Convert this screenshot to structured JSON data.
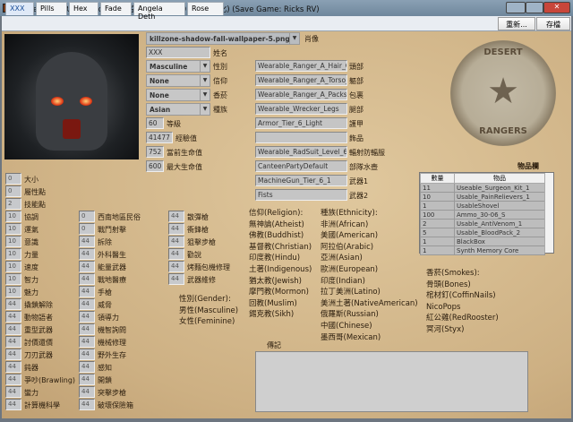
{
  "window": {
    "title": "Wasteland 2 Ranger Editor (天空的暑假(a8690145)中文化) (Save Game: Ricks RV)"
  },
  "tabs": [
    "XXX",
    "Pills",
    "Hex",
    "Fade",
    "Angela Deth",
    "Rose"
  ],
  "toolbar": {
    "reload": "重新...",
    "save": "存檔"
  },
  "portrait": {
    "value": "killzone-shadow-fall-wallpaper-5.png",
    "label": "肖像"
  },
  "name": {
    "value": "XXX",
    "label": "姓名"
  },
  "selects": [
    {
      "value": "Masculine",
      "label": "性別"
    },
    {
      "value": "None",
      "label": "信仰"
    },
    {
      "value": "None",
      "label": "香菸"
    },
    {
      "value": "Asian",
      "label": "種族"
    }
  ],
  "level_fields": [
    {
      "value": "60",
      "label": "等級"
    },
    {
      "value": "41477",
      "label": "經驗值"
    },
    {
      "value": "752",
      "label": "當前生命值"
    },
    {
      "value": "600",
      "label": "最大生命值"
    }
  ],
  "equipment": [
    {
      "value": "Wearable_Ranger_A_Hair_C",
      "label": "頭部"
    },
    {
      "value": "Wearable_Ranger_A_Torso_E",
      "label": "軀部"
    },
    {
      "value": "Wearable_Ranger_A_Packs_C",
      "label": "包裹"
    },
    {
      "value": "Wearable_Wrecker_Legs",
      "label": "腿部"
    },
    {
      "value": "Armor_Tier_6_Light",
      "label": "護甲"
    },
    {
      "value": "",
      "label": "飾品"
    },
    {
      "value": "Wearable_RadSuit_Level_6",
      "label": "輻射防輻服"
    },
    {
      "value": "CanteenPartyDefault",
      "label": "部隊水壺"
    },
    {
      "value": "MachineGun_Tier_6_1",
      "label": "武器1"
    },
    {
      "value": "Fists",
      "label": "武器2"
    }
  ],
  "stats_col1": [
    {
      "v": "0",
      "l": "大小"
    },
    {
      "v": "0",
      "l": "屬性點"
    },
    {
      "v": "2",
      "l": "技能點"
    },
    {
      "v": "10",
      "l": "協調"
    },
    {
      "v": "10",
      "l": "運氣"
    },
    {
      "v": "10",
      "l": "意識"
    },
    {
      "v": "10",
      "l": "力量"
    },
    {
      "v": "10",
      "l": "速度"
    },
    {
      "v": "10",
      "l": "智力"
    },
    {
      "v": "10",
      "l": "魅力"
    },
    {
      "v": "44",
      "l": "撬鎖解除"
    },
    {
      "v": "44",
      "l": "動物語者"
    },
    {
      "v": "44",
      "l": "重型武器"
    },
    {
      "v": "44",
      "l": "討價還價"
    },
    {
      "v": "44",
      "l": "刀刃武器"
    },
    {
      "v": "44",
      "l": "鈍器"
    },
    {
      "v": "44",
      "l": "爭吵(Brawling)"
    },
    {
      "v": "44",
      "l": "蠻力"
    },
    {
      "v": "44",
      "l": "計算機科學"
    }
  ],
  "stats_col2": [
    {
      "v": "0",
      "l": "西南地區民俗"
    },
    {
      "v": "0",
      "l": "戰鬥射擊"
    },
    {
      "v": "44",
      "l": "拆除"
    },
    {
      "v": "44",
      "l": "外科醫生"
    },
    {
      "v": "44",
      "l": "能量武器"
    },
    {
      "v": "44",
      "l": "戰地醫療"
    },
    {
      "v": "44",
      "l": "手槍"
    },
    {
      "v": "44",
      "l": "威脅"
    },
    {
      "v": "44",
      "l": "領導力"
    },
    {
      "v": "44",
      "l": "機智詢問"
    },
    {
      "v": "44",
      "l": "機械修理"
    },
    {
      "v": "44",
      "l": "野外生存"
    },
    {
      "v": "44",
      "l": "感知"
    },
    {
      "v": "44",
      "l": "開鎖"
    },
    {
      "v": "44",
      "l": "突擊步槍"
    },
    {
      "v": "44",
      "l": "破壞保險箱"
    }
  ],
  "stats_col3": [
    {
      "v": "44",
      "l": "散彈槍"
    },
    {
      "v": "44",
      "l": "衝鋒槍"
    },
    {
      "v": "44",
      "l": "狙擊步槍"
    },
    {
      "v": "44",
      "l": "勸說"
    },
    {
      "v": "44",
      "l": "烤麵包機修理"
    },
    {
      "v": "44",
      "l": "武器維修"
    }
  ],
  "gender_ref": [
    "性別(Gender):",
    "男性(Masculine)",
    "女性(Feminine)"
  ],
  "religion_ref": [
    "信仰(Religion):",
    "無神論(Atheist)",
    "佛教(Buddhist)",
    "基督教(Christian)",
    "印度教(Hindu)",
    "土著(Indigenous)",
    "猶太教(Jewish)",
    "摩門教(Mormon)",
    "回教(Muslim)",
    "錫克教(Sikh)"
  ],
  "ethnicity_ref": [
    "種族(Ethnicity):",
    "非洲(African)",
    "美國(American)",
    "阿拉伯(Arabic)",
    "亞洲(Asian)",
    "歐洲(European)",
    "印度(Indian)",
    "拉丁美洲(Latino)",
    "美洲土著(NativeAmerican)",
    "俄羅斯(Russian)",
    "中國(Chinese)",
    "墨西哥(Mexican)"
  ],
  "smokes_ref": [
    "香菸(Smokes):",
    "骨頭(Bones)",
    "棺材釘(CoffinNails)",
    "NicoPops",
    "紅公雞(RedRooster)",
    "冥河(Styx)"
  ],
  "inventory": {
    "title": "物品欄",
    "headers": [
      "數量",
      "物品"
    ],
    "rows": [
      [
        "11",
        "Useable_Surgeon_Kit_1"
      ],
      [
        "10",
        "Usable_PainRelievers_1"
      ],
      [
        "1",
        "UsableShovel"
      ],
      [
        "100",
        "Ammo_30-06_S"
      ],
      [
        "2",
        "Usable_AntiVenom_1"
      ],
      [
        "5",
        "Usable_BloodPack_2"
      ],
      [
        "1",
        "BlackBox"
      ],
      [
        "1",
        "Synth Memory Core"
      ]
    ]
  },
  "notes": {
    "label": "傳記",
    "value": ""
  },
  "logo": {
    "text_top": "DESERT",
    "text_bottom": "RANGERS"
  }
}
